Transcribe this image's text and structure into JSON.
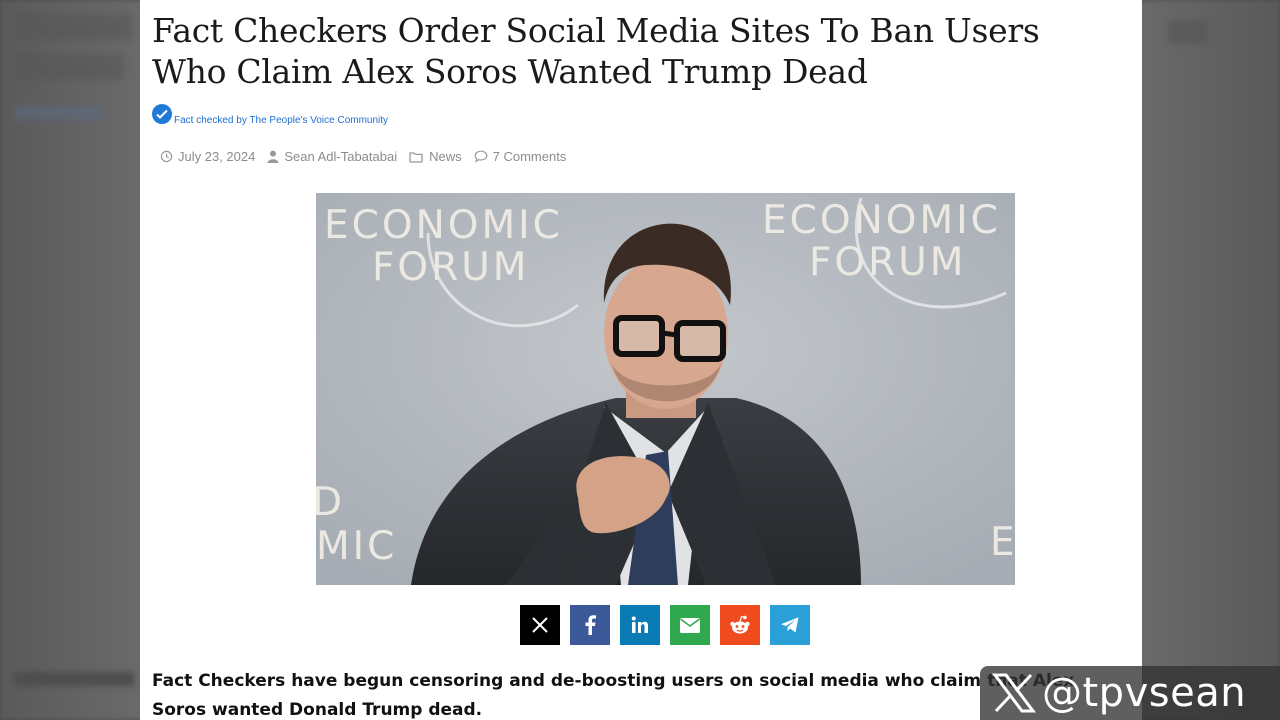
{
  "article": {
    "headline": "Fact Checkers Order Social Media Sites To Ban Users Who Claim Alex Soros Wanted Trump Dead",
    "fact_check": "Fact checked by The People's Voice Community",
    "meta": {
      "date": "July 23, 2024",
      "author": "Sean Adl-Tabatabai",
      "category": "News",
      "comments": "7 Comments"
    },
    "image": {
      "backdrop_text_left": [
        "ECONOMIC",
        "FORUM"
      ],
      "backdrop_text_right": [
        "ECONOMIC",
        "FORUM"
      ],
      "backdrop_text_lower_left": [
        "D",
        "MIC"
      ],
      "backdrop_text_lower_right": "E"
    },
    "share_buttons": [
      {
        "name": "x-share",
        "icon": "x-icon",
        "color": "#000000"
      },
      {
        "name": "facebook-share",
        "icon": "facebook-icon",
        "color": "#3b5998"
      },
      {
        "name": "linkedin-share",
        "icon": "linkedin-icon",
        "color": "#0a7bb5"
      },
      {
        "name": "email-share",
        "icon": "envelope-icon",
        "color": "#2fa84f"
      },
      {
        "name": "reddit-share",
        "icon": "reddit-icon",
        "color": "#f04a1f"
      },
      {
        "name": "telegram-share",
        "icon": "telegram-icon",
        "color": "#2a9fd8"
      }
    ],
    "lead": "Fact Checkers have begun censoring and de-boosting users on social media who claim that Alex Soros wanted Donald Trump dead."
  },
  "watermark": {
    "handle": "@tpvsean",
    "icon": "x-logo-icon"
  },
  "colors": {
    "link_blue": "#1f6fcf",
    "meta_gray": "#8c8c8c"
  }
}
